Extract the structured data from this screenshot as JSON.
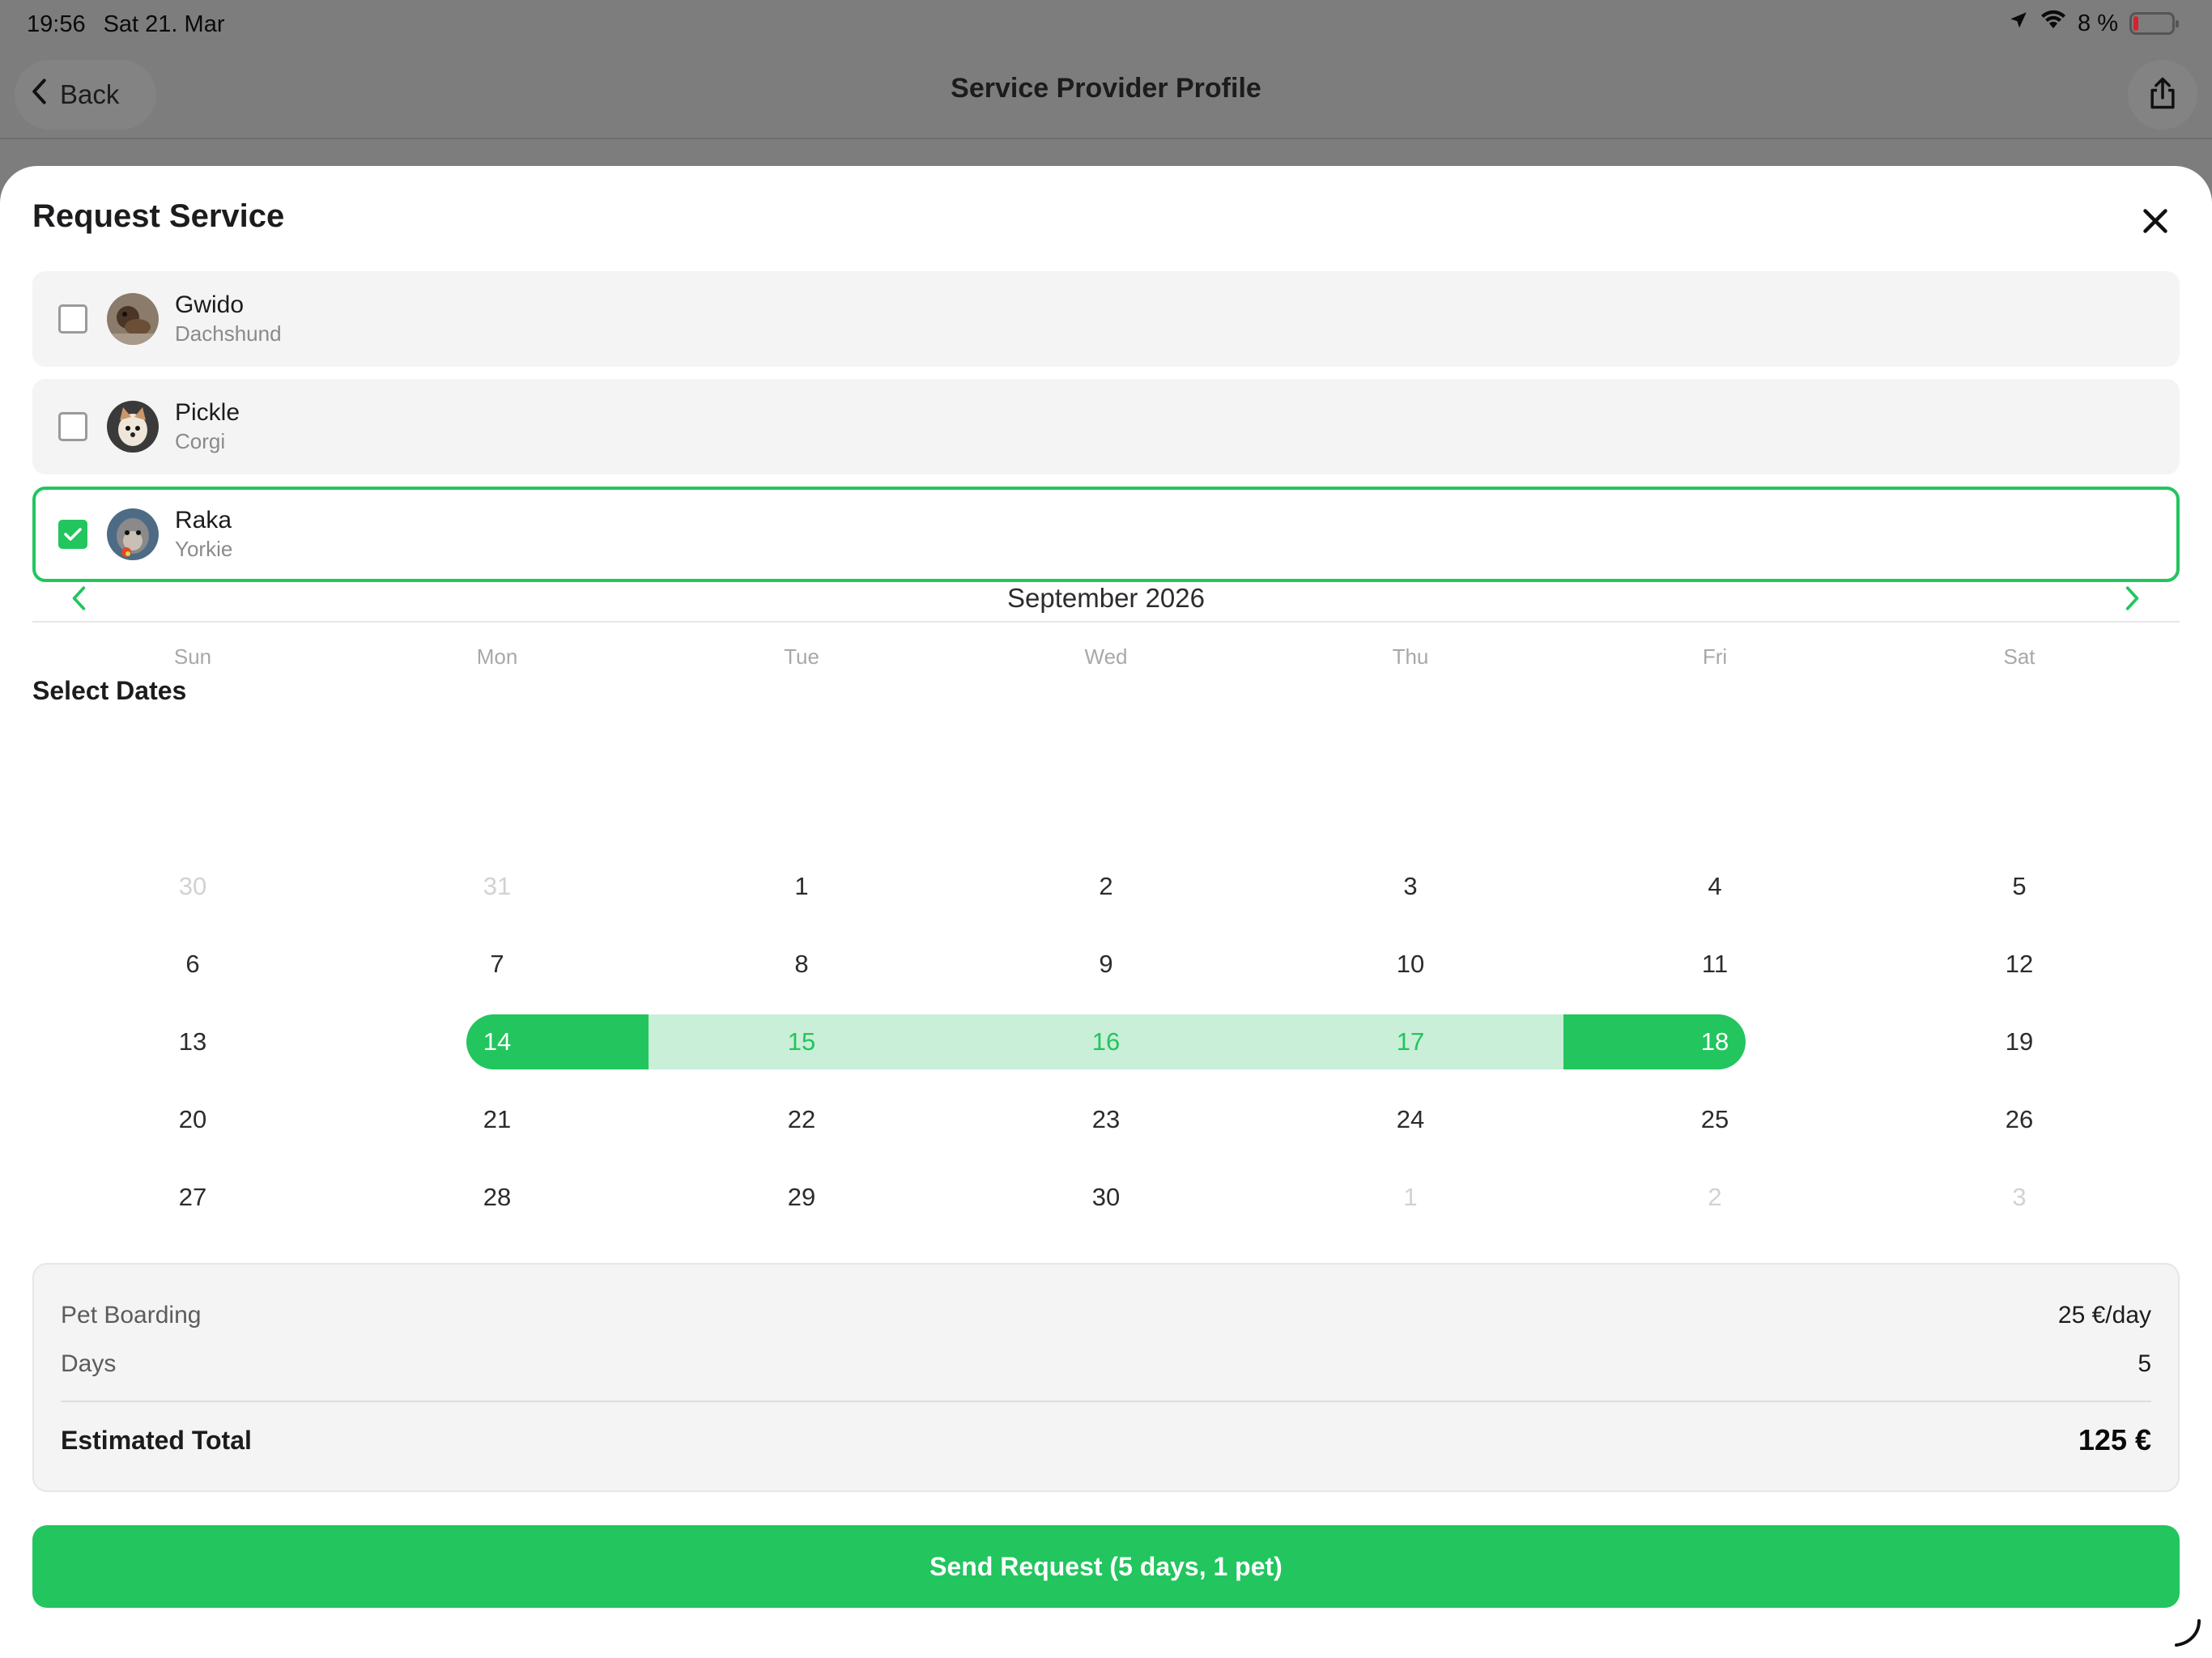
{
  "status": {
    "time": "19:56",
    "date": "Sat 21. Mar",
    "battery": "8 %"
  },
  "nav": {
    "back_label": "Back",
    "title": "Service Provider Profile"
  },
  "sheet": {
    "title": "Request Service"
  },
  "pets": [
    {
      "name": "Gwido",
      "breed": "Dachshund",
      "selected": false
    },
    {
      "name": "Pickle",
      "breed": "Corgi",
      "selected": false
    },
    {
      "name": "Raka",
      "breed": "Yorkie",
      "selected": true
    }
  ],
  "dates": {
    "section_title": "Select Dates",
    "month": "September 2026",
    "weekdays": [
      "Sun",
      "Mon",
      "Tue",
      "Wed",
      "Thu",
      "Fri",
      "Sat"
    ],
    "weeks": [
      [
        "30",
        "31",
        "1",
        "2",
        "3",
        "4",
        "5"
      ],
      [
        "6",
        "7",
        "8",
        "9",
        "10",
        "11",
        "12"
      ],
      [
        "13",
        "14",
        "15",
        "16",
        "17",
        "18",
        "19"
      ],
      [
        "20",
        "21",
        "22",
        "23",
        "24",
        "25",
        "26"
      ],
      [
        "27",
        "28",
        "29",
        "30",
        "1",
        "2",
        "3"
      ]
    ],
    "range_start": "14",
    "range_end": "18"
  },
  "summary": {
    "service_label": "Pet Boarding",
    "service_rate": "25 €/day",
    "days_label": "Days",
    "days_value": "5",
    "total_label": "Estimated Total",
    "total_value": "125 €"
  },
  "send_button": "Send Request (5 days, 1 pet)",
  "colors": {
    "accent": "#22c55e",
    "range_fill": "#c9efd8"
  }
}
